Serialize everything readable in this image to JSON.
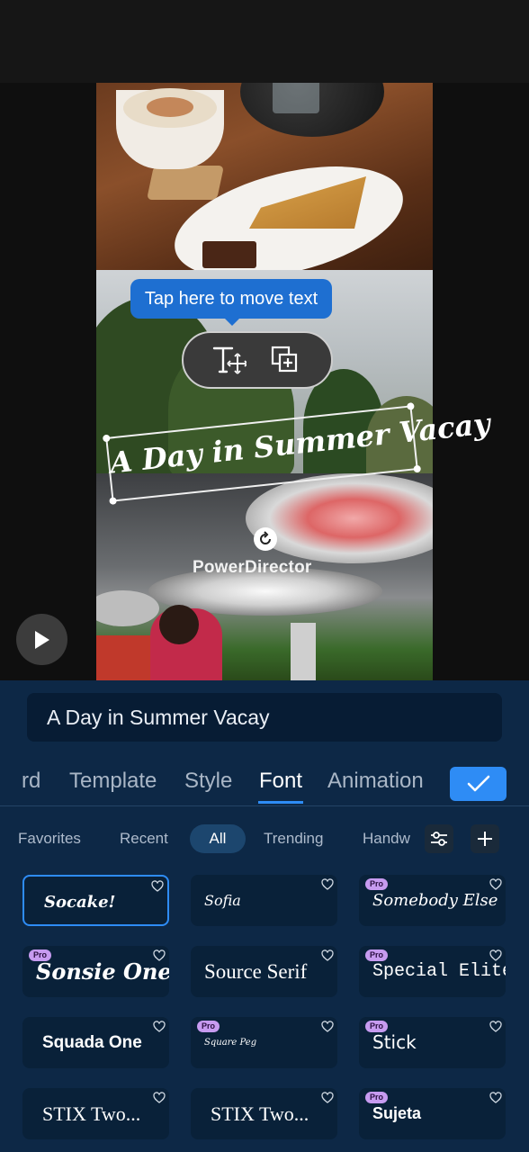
{
  "overlay": {
    "tooltip": "Tap here to move text",
    "caption": "A Day in Summer Vacay",
    "watermark": "PowerDirector"
  },
  "editor": {
    "text_value": "A Day in Summer Vacay"
  },
  "tabs": [
    {
      "label": "rd"
    },
    {
      "label": "Template"
    },
    {
      "label": "Style"
    },
    {
      "label": "Font",
      "active": true
    },
    {
      "label": "Animation"
    }
  ],
  "filters": [
    {
      "label": "Favorites"
    },
    {
      "label": "Recent"
    },
    {
      "label": "All",
      "active": true
    },
    {
      "label": "Trending"
    },
    {
      "label": "Handw"
    }
  ],
  "fonts": [
    {
      "name": "Socake!",
      "pro": false,
      "selected": true
    },
    {
      "name": "Sofia",
      "pro": false
    },
    {
      "name": "Somebody Else",
      "pro": true
    },
    {
      "name": "Sonsie One",
      "pro": true
    },
    {
      "name": "Source Serif",
      "pro": false
    },
    {
      "name": "Special Elite",
      "pro": true
    },
    {
      "name": "Squada One",
      "pro": false
    },
    {
      "name": "Square Peg",
      "pro": true
    },
    {
      "name": "Stick",
      "pro": true
    },
    {
      "name": "STIX Two...",
      "pro": false
    },
    {
      "name": "STIX Two...",
      "pro": false
    },
    {
      "name": "Sujeta",
      "pro": true
    }
  ],
  "badges": {
    "pro": "Pro"
  },
  "colors": {
    "accent": "#2e8cf5",
    "panel": "#0d2846",
    "card": "#092139",
    "pro_badge": "#c79bf0"
  }
}
